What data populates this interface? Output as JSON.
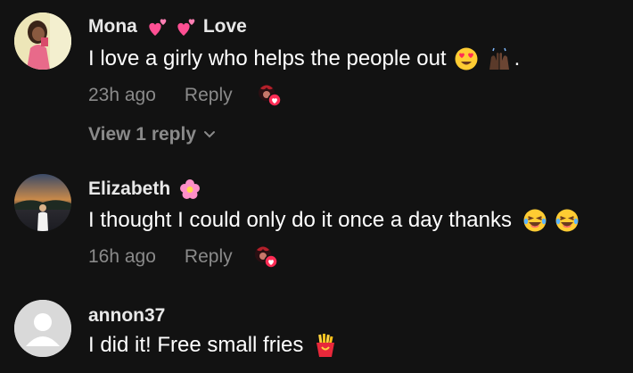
{
  "comments": [
    {
      "username": "Mona",
      "username_suffix": "Love",
      "text": "I love a girly who helps the people out",
      "text_trailing": ".",
      "time": "23h ago",
      "reply_label": "Reply",
      "view_replies": "View 1 reply",
      "emojis": [
        "two-hearts-icon",
        "two-hearts-icon",
        "heart-eyes-icon",
        "raised-hands-icon"
      ]
    },
    {
      "username": "Elizabeth",
      "text": "I thought I could only do it once a day thanks",
      "time": "16h ago",
      "reply_label": "Reply",
      "emojis": [
        "flower-icon",
        "laughing-icon",
        "laughing-icon"
      ]
    },
    {
      "username": "annon37",
      "text": "I did it! Free small fries",
      "emojis": [
        "fries-icon"
      ]
    }
  ],
  "colors": {
    "background": "#121212",
    "muted": "#8a8a8a",
    "accent": "#fe2c55"
  }
}
